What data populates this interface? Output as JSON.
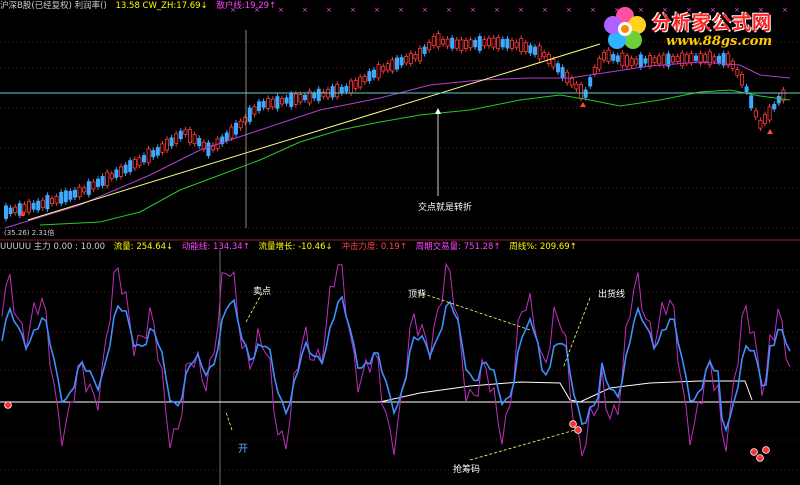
{
  "window": {
    "top_header": [
      {
        "text": "沪深B股(已经复权)  利润率()",
        "color": "#cccccc"
      },
      {
        "text": "13.58  CW_ZH:17.69↓",
        "color": "#ffff00"
      },
      {
        "text": "散户线:19.29↑",
        "color": "#ff44ff"
      }
    ],
    "sub_header": [
      {
        "text": "UUUUU 主力 0.00 : 10.00",
        "color": "#cccccc"
      },
      {
        "text": "流量: 254.64↓",
        "color": "#ffff00"
      },
      {
        "text": "动能线: 134.34↑",
        "color": "#ff44ff"
      },
      {
        "text": "流量增长: -10.46↓",
        "color": "#ffff00"
      },
      {
        "text": "冲击力度: 0.19↑",
        "color": "#ff4444"
      },
      {
        "text": "周期交易量: 751.28↑",
        "color": "#ff44ff"
      },
      {
        "text": "周线%: 209.69↑",
        "color": "#ffff00"
      }
    ],
    "bottom_left_small": "(35.26) 2.31倍"
  },
  "watermark": {
    "title": "分析家公式网",
    "url": "www.88gs.com"
  },
  "annotations": {
    "cross_point": "交点就是转折",
    "buy_point": "卖点",
    "bottom": "顶背",
    "exit_line": "出货线",
    "chips": "抢筹码",
    "cursor_label": "开"
  },
  "colors": {
    "up_candle": "#ff3b3b",
    "down_candle": "#3fa9ff",
    "ma_purple": "#b040d0",
    "ma_green": "#28c828",
    "trend_line": "#ffff88",
    "grid_red": "#6a1010",
    "hline_cyan": "#5fd0d0",
    "osc_blue": "#3f8fff",
    "osc_magenta": "#c030c0",
    "osc_white": "#ffffff",
    "signal_dot": "#ff3030"
  },
  "icons": {
    "watermark_logo": "flower-logo-icon",
    "crosshair": "crosshair-icon"
  }
}
